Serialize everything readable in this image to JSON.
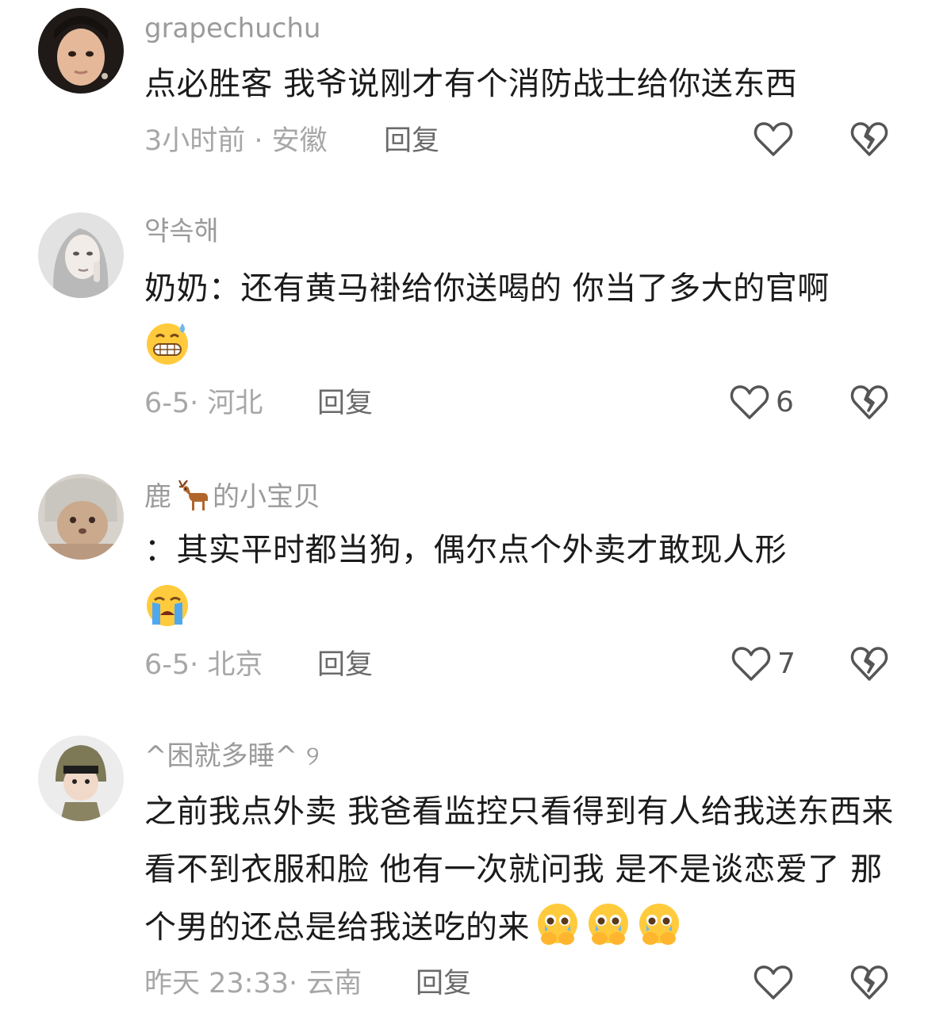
{
  "comments": [
    {
      "username": "grapechuchu",
      "text": "点必胜客 我爷说刚才有个消防战士给你送东西",
      "emojis": [],
      "meta": "3小时前 · 安徽",
      "reply_label": "回复",
      "likes": "",
      "avatar_colors": {
        "bg": "#c9a48a",
        "hair": "#1a1410",
        "skin": "#e7c1a3"
      }
    },
    {
      "username": "약속해",
      "text": "奶奶：还有黄马褂给你送喝的 你当了多大的官啊",
      "emojis": [
        "grimace-sweat"
      ],
      "meta": "6-5· 河北",
      "reply_label": "回复",
      "likes": "6",
      "avatar_colors": {
        "bg": "#dcdcdc",
        "hair": "#bfbfbf",
        "skin": "#efe8e4"
      }
    },
    {
      "username_parts": [
        "鹿",
        "的小宝贝"
      ],
      "username_emoji": "deer",
      "text": "：其实平时都当狗，偶尔点个外卖才敢现人形",
      "emojis": [
        "loudly-crying"
      ],
      "meta": "6-5· 北京",
      "reply_label": "回复",
      "likes": "7",
      "avatar_colors": {
        "bg": "#d8d2cb",
        "fur": "#c7a88e",
        "cloth": "#9d9a94"
      }
    },
    {
      "username": "^困就多睡^ ୨",
      "text": "之前我点外卖 我爸看监控只看得到有人给我送东西来看不到衣服和脸 他有一次就问我 是不是谈恋爱了 那个男的还总是给我送吃的来",
      "emojis": [
        "face-holding-back-tears",
        "face-holding-back-tears",
        "face-holding-back-tears"
      ],
      "meta": "昨天 23:33· 云南",
      "reply_label": "回复",
      "likes": "",
      "avatar_colors": {
        "bg": "#e9e9e9",
        "hat": "#7f7a5c",
        "skin": "#f0d8c8"
      }
    }
  ],
  "icons": {
    "like": "heart-outline-icon",
    "dislike": "broken-heart-icon"
  },
  "colors": {
    "username": "#9b9b9b",
    "text": "#1b1b1b",
    "meta": "#a7a7a7",
    "reply": "#6a6a6a",
    "icon_stroke": "#555555"
  }
}
